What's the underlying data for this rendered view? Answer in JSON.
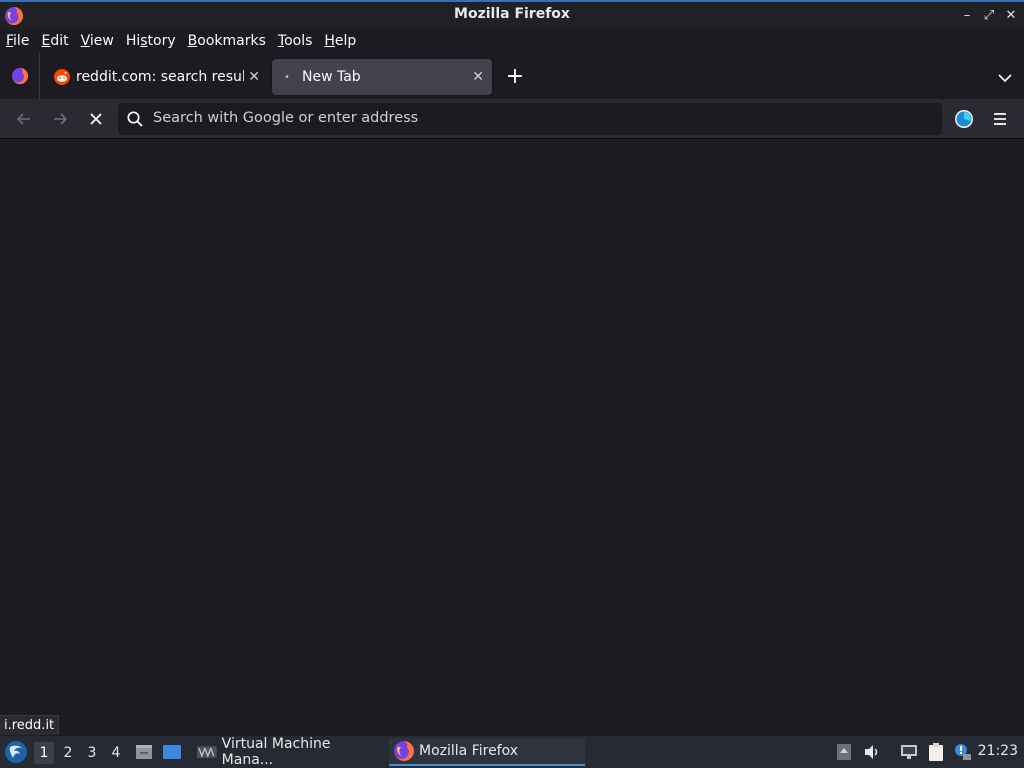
{
  "window": {
    "title": "Mozilla Firefox"
  },
  "menubar": {
    "items": [
      {
        "label": "File",
        "key": "F"
      },
      {
        "label": "Edit",
        "key": "E"
      },
      {
        "label": "View",
        "key": "V"
      },
      {
        "label": "History",
        "key": "s"
      },
      {
        "label": "Bookmarks",
        "key": "B"
      },
      {
        "label": "Tools",
        "key": "T"
      },
      {
        "label": "Help",
        "key": "H"
      }
    ]
  },
  "tabs": [
    {
      "label": "reddit.com: search result",
      "icon": "reddit-icon",
      "active": false
    },
    {
      "label": "New Tab",
      "icon": "dot-icon",
      "active": true
    }
  ],
  "navbar": {
    "url_placeholder": "Search with Google or enter address"
  },
  "status": {
    "text": "i.redd.it"
  },
  "taskbar": {
    "workspaces": [
      "1",
      "2",
      "3",
      "4"
    ],
    "active_workspace": "1",
    "tasks": [
      {
        "label": "Virtual Machine Mana...",
        "icon": "virt-manager-icon",
        "active": false
      },
      {
        "label": "Mozilla Firefox",
        "icon": "firefox-icon",
        "active": true
      }
    ],
    "clock": "21:23"
  },
  "colors": {
    "content_bg": "#1c1b22",
    "toolbar_bg": "#2b2a33",
    "active_tab_bg": "#42414d",
    "taskbar_bg": "#262a33",
    "accent": "#3d8fd6"
  }
}
